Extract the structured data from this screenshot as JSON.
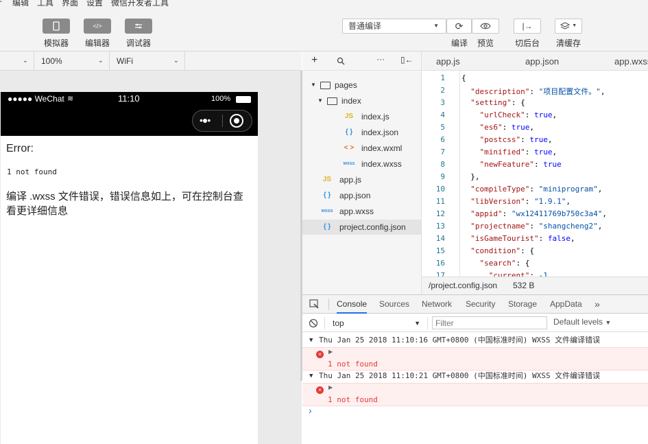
{
  "menu": [
    "编辑",
    "工具",
    "界面",
    "设置",
    "微信开发者工具"
  ],
  "toolbar": {
    "left_buttons": [
      {
        "label": "模拟器",
        "icon": "phone-icon"
      },
      {
        "label": "编辑器",
        "icon": "code-icon"
      },
      {
        "label": "调试器",
        "icon": "debug-icon"
      }
    ],
    "compile_select": "普通编译",
    "right_buttons": [
      {
        "label": "编译",
        "icon": "refresh-icon"
      },
      {
        "label": "预览",
        "icon": "eye-icon"
      },
      {
        "label": "切后台",
        "icon": "background-icon"
      },
      {
        "label": "清缓存",
        "icon": "layers-icon"
      }
    ]
  },
  "device_bar": {
    "device": "",
    "zoom": "100%",
    "network": "WiFi"
  },
  "phone": {
    "status_carrier": "●●●●● WeChat",
    "status_time": "11:10",
    "status_battery": "100%",
    "error_title": "Error:",
    "error_code": "1 not found",
    "error_message": "编译 .wxss 文件错误，错误信息如上，可在控制台查看更详细信息"
  },
  "file_tree": [
    {
      "name": "pages",
      "type": "folder",
      "level": 0,
      "icon": "folder-icon"
    },
    {
      "name": "index",
      "type": "folder",
      "level": 1,
      "icon": "folder-icon"
    },
    {
      "name": "index.js",
      "type": "js",
      "level": 2,
      "badge": "JS"
    },
    {
      "name": "index.json",
      "type": "json",
      "level": 2,
      "badge": "{ }"
    },
    {
      "name": "index.wxml",
      "type": "wxml",
      "level": 2,
      "badge": "< >"
    },
    {
      "name": "index.wxss",
      "type": "wxss",
      "level": 2,
      "badge": "wxss"
    },
    {
      "name": "app.js",
      "type": "js",
      "level": 0,
      "badge": "JS"
    },
    {
      "name": "app.json",
      "type": "json",
      "level": 0,
      "badge": "{ }"
    },
    {
      "name": "app.wxss",
      "type": "wxss",
      "level": 0,
      "badge": "wxss"
    },
    {
      "name": "project.config.json",
      "type": "json",
      "level": 0,
      "badge": "{ }",
      "selected": true
    }
  ],
  "editor_tabs": [
    "app.js",
    "app.json",
    "app.wxss"
  ],
  "code_lines": [
    "{",
    "  \"description\": \"项目配置文件。\",",
    "  \"setting\": {",
    "    \"urlCheck\": true,",
    "    \"es6\": true,",
    "    \"postcss\": true,",
    "    \"minified\": true,",
    "    \"newFeature\": true",
    "  },",
    "  \"compileType\": \"miniprogram\",",
    "  \"libVersion\": \"1.9.1\",",
    "  \"appid\": \"wx12411769b750c3a4\",",
    "  \"projectname\": \"shangcheng2\",",
    "  \"isGameTourist\": false,",
    "  \"condition\": {",
    "    \"search\": {",
    "      \"current\": -1,"
  ],
  "editor_status": {
    "path": "/project.config.json",
    "size": "532 B"
  },
  "console": {
    "tabs": [
      "Console",
      "Sources",
      "Network",
      "Security",
      "Storage",
      "AppData"
    ],
    "active_tab": "Console",
    "context": "top",
    "filter_placeholder": "Filter",
    "levels": "Default levels",
    "logs": [
      {
        "header": "Thu Jan 25 2018 11:10:16 GMT+0800 (中国标准时间) WXSS 文件编译错误",
        "message": "1 not found"
      },
      {
        "header": "Thu Jan 25 2018 11:10:21 GMT+0800 (中国标准时间) WXSS 文件编译错误",
        "message": "1 not found"
      }
    ],
    "prompt": "›"
  },
  "colors": {
    "accent": "#1a73e8",
    "error": "#e53935",
    "json_key": "#a31515",
    "json_string": "#0451a5"
  }
}
